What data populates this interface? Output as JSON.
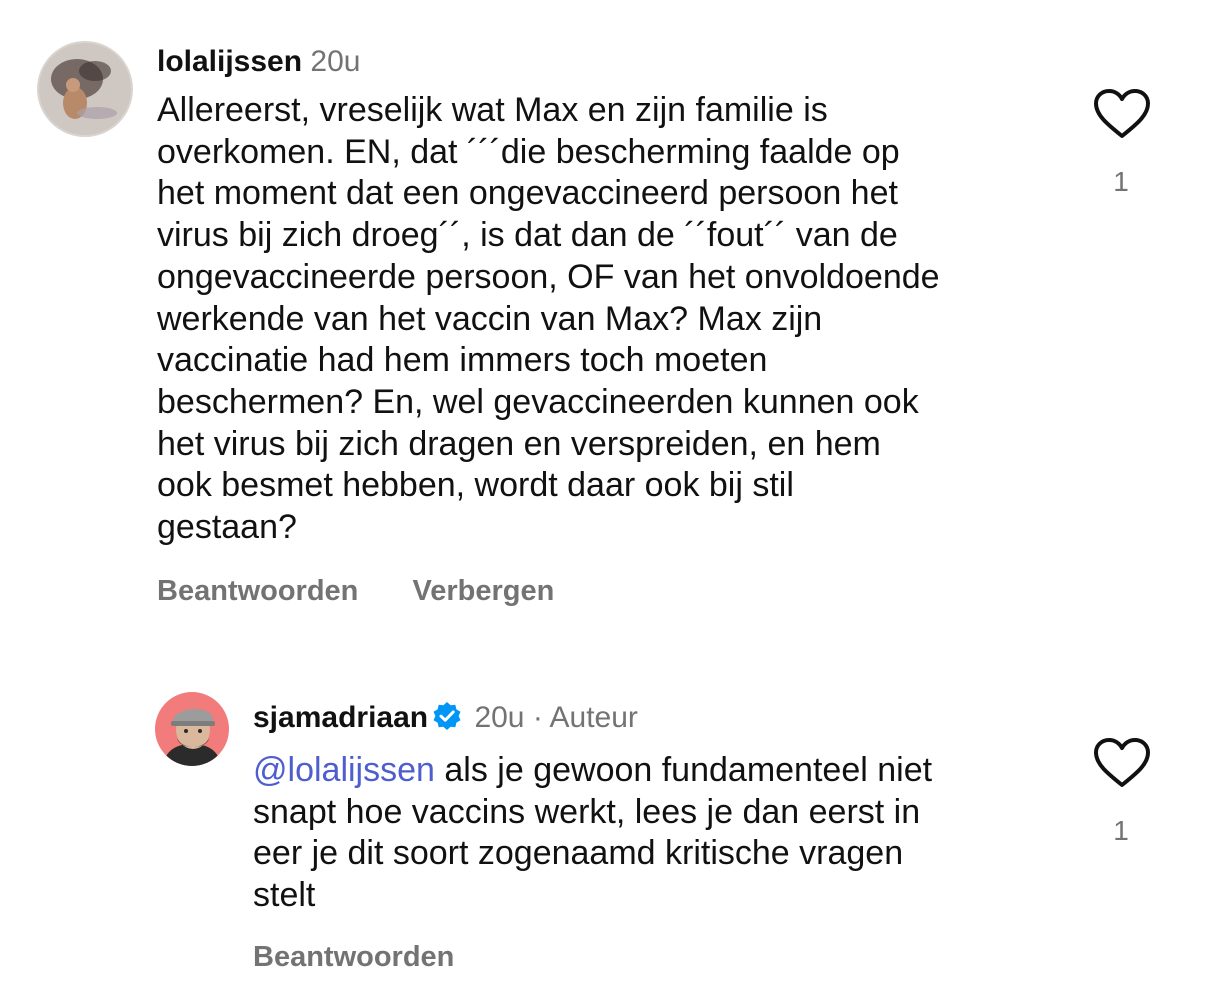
{
  "comments": [
    {
      "username": "lolalijssen",
      "time": "20u",
      "lines": [
        "Allereerst, vreselijk wat Max en zijn familie is",
        "overkomen. EN, dat ´´´die bescherming faalde op",
        "het moment dat een ongevaccineerd persoon het",
        "virus bij zich droeg´´, is dat dan de ´´fout´´ van de",
        "ongevaccineerde persoon, OF van het onvoldoende",
        "werkende van het vaccin van Max? Max zijn",
        "vaccinatie had hem immers toch moeten",
        "beschermen? En, wel gevaccineerden kunnen ook",
        "het virus bij zich dragen en verspreiden, en hem",
        "ook besmet hebben, wordt daar ook bij stil",
        "gestaan?"
      ],
      "reply_label": "Beantwoorden",
      "hide_label": "Verbergen",
      "like_count": "1"
    },
    {
      "username": "sjamadriaan",
      "time": "20u",
      "separator": "·",
      "author_tag": "Auteur",
      "mention": "@lolalijssen",
      "lines": [
        "als je gewoon fundamenteel niet",
        "snapt hoe vaccins werkt, lees je dan eerst in",
        "eer je dit soort zogenaamd kritische vragen",
        "stelt"
      ],
      "reply_label": "Beantwoorden",
      "like_count": "1"
    }
  ],
  "colors": {
    "text": "#111111",
    "muted": "#737373",
    "mention": "#4f5ecf",
    "verified": "#0095f6"
  },
  "icons": {
    "like": "heart-outline-icon",
    "verified": "verified-badge-icon"
  }
}
